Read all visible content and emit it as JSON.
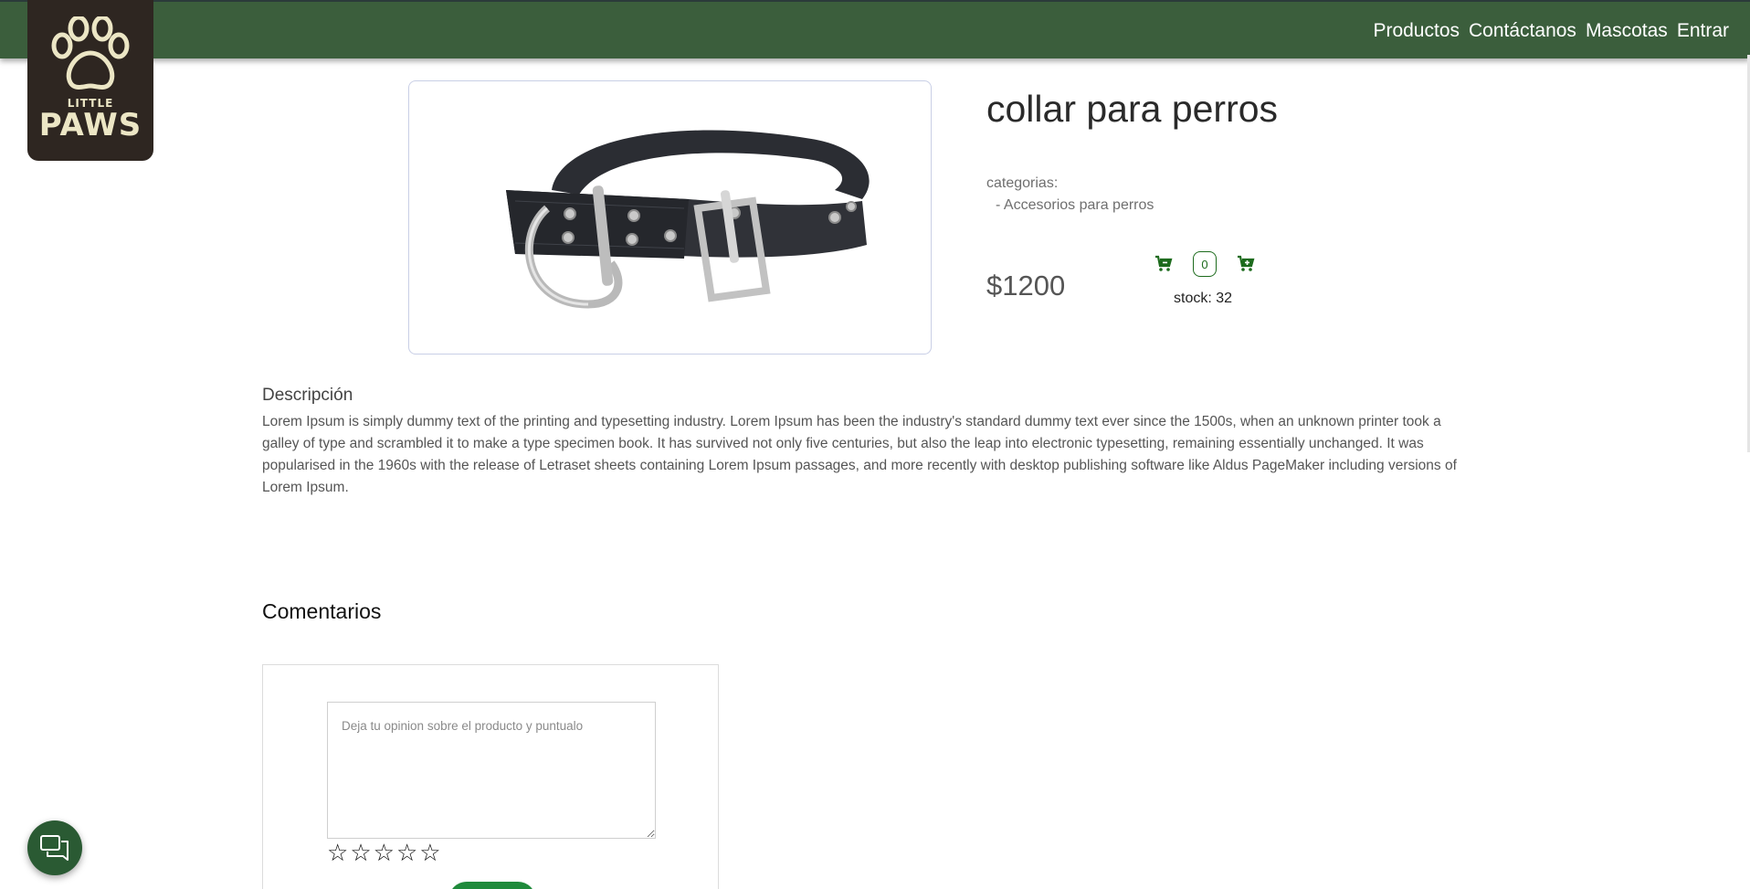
{
  "nav": {
    "links": [
      "Productos",
      "Contáctanos",
      "Mascotas",
      "Entrar"
    ]
  },
  "logo": {
    "line1": "LITTLE",
    "line2": "PAWS"
  },
  "product": {
    "title": "collar para perros",
    "categories_label": "categorias:",
    "categories": [
      "- Accesorios para perros"
    ],
    "price": "$1200",
    "quantity": "0",
    "stock": "stock: 32"
  },
  "description": {
    "title": "Descripción",
    "text": "Lorem Ipsum is simply dummy text of the printing and typesetting industry. Lorem Ipsum has been the industry's standard dummy text ever since the 1500s, when an unknown printer took a galley of type and scrambled it to make a type specimen book. It has survived not only five centuries, but also the leap into electronic typesetting, remaining essentially unchanged. It was popularised in the 1960s with the release of Letraset sheets containing Lorem Ipsum passages, and more recently with desktop publishing software like Aldus PageMaker including versions of Lorem Ipsum."
  },
  "comments": {
    "title": "Comentarios",
    "placeholder": "Deja tu opinion sobre el producto y puntualo",
    "rating": 0,
    "stars": [
      "☆",
      "☆",
      "☆",
      "☆",
      "☆"
    ]
  },
  "icons": {
    "cart_remove": "cart-remove-icon",
    "cart_add": "cart-add-icon",
    "chat": "chat-icon"
  },
  "colors": {
    "navbar": "#3b5e3c",
    "logo_bg": "#2e2621",
    "accent_green": "#1d6b1d",
    "button_green": "#1f8a3b"
  }
}
